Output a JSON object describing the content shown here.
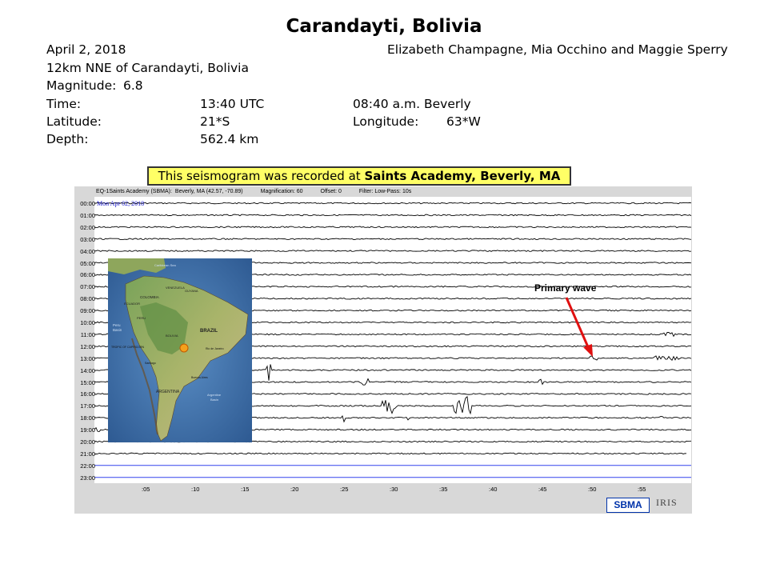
{
  "title": "Carandayti, Bolivia",
  "date": "April 2, 2018",
  "authors": "Elizabeth Champagne, Mia Occhino and Maggie Sperry",
  "location": "12km NNE of Carandayti, Bolivia",
  "magnitude_label": "Magnitude:",
  "magnitude_value": "6.8",
  "time_label": "Time:",
  "time_utc": "13:40 UTC",
  "time_local": "08:40 a.m. Beverly",
  "latitude_label": "Latitude:",
  "latitude_value": "21*S",
  "longitude_label": "Longitude:",
  "longitude_value": "63*W",
  "depth_label": "Depth:",
  "depth_value": "562.4 km",
  "banner": {
    "prefix": "This seismogram was recorded at ",
    "station": "Saints Academy, Beverly, MA"
  },
  "seismogram": {
    "header_station": "EQ-1Saints Academy (SBMA):",
    "header_coords": "Beverly, MA (42.57, -70.89)",
    "header_magnification": "Magnification: 60",
    "header_offset": "Offset: 0",
    "header_filter": "Filter: Low-Pass: 10s",
    "date_label": "Mon Apr 02, 2018",
    "hours": [
      "00:00",
      "01:00",
      "02:00",
      "03:00",
      "04:00",
      "05:00",
      "06:00",
      "07:00",
      "08:00",
      "09:00",
      "10:00",
      "11:00",
      "12:00",
      "13:00",
      "14:00",
      "15:00",
      "16:00",
      "17:00",
      "18:00",
      "19:00",
      "20:00",
      "21:00",
      "22:00",
      "23:00"
    ],
    "minutes": [
      ":05",
      ":10",
      ":15",
      ":20",
      ":25",
      ":30",
      ":35",
      ":40",
      ":45",
      ":50",
      ":55"
    ],
    "annotation": "Primary wave",
    "logo_sbma": "SBMA",
    "logo_iris": "IRIS",
    "trace_color": "#000000",
    "blank_trace_color": "#3344ee"
  },
  "map": {
    "labels": [
      "Caribbean Sea",
      "VENEZUELA",
      "COLOMBIA",
      "GUYANA",
      "ECUADOR",
      "PERU",
      "BRAZIL",
      "BOLIVIA",
      "ARGENTINA",
      "TROPIC OF CAPRICORN",
      "Peru Basin",
      "Rio de Janeiro",
      "Buenos Aires",
      "Argentine Basin",
      "Santiago"
    ]
  }
}
